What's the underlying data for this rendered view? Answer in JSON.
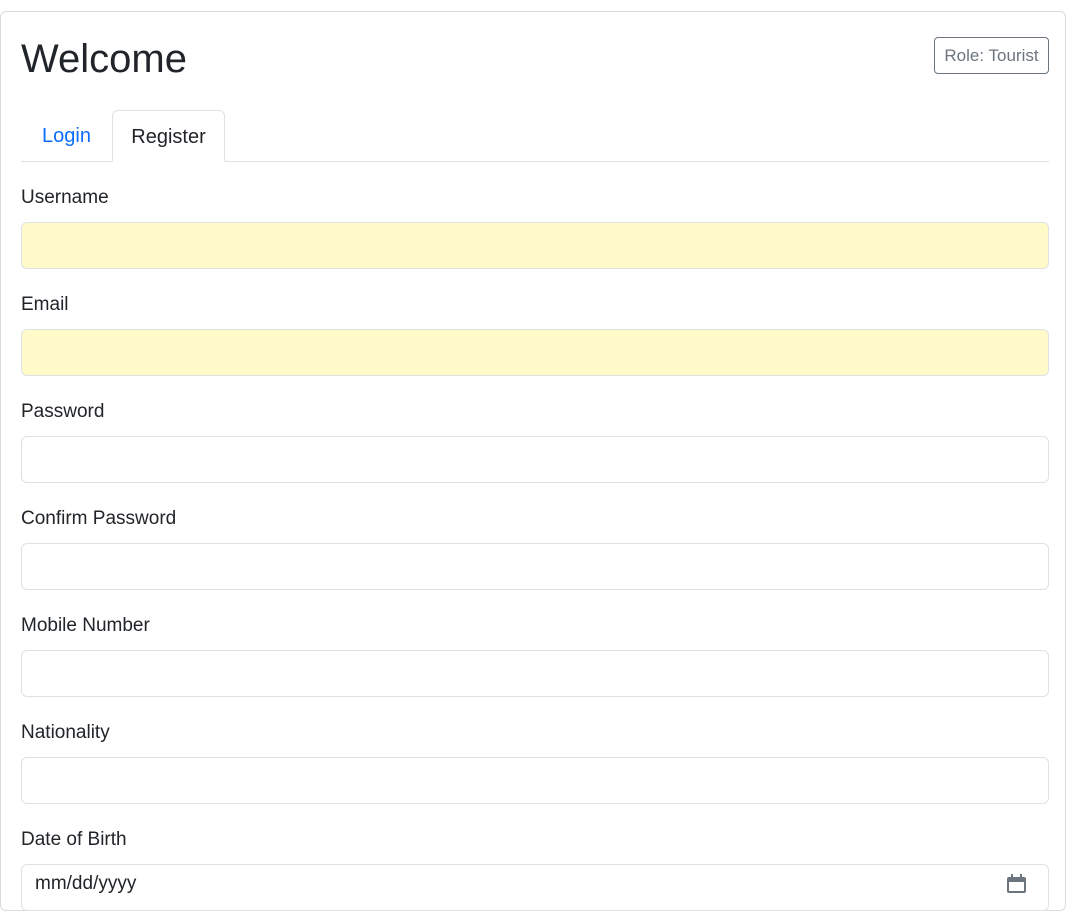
{
  "header": {
    "title": "Welcome",
    "role_badge": "Role: Tourist"
  },
  "tabs": [
    {
      "label": "Login",
      "active": false
    },
    {
      "label": "Register",
      "active": true
    }
  ],
  "form": {
    "username_label": "Username",
    "username_value": "",
    "email_label": "Email",
    "email_value": "",
    "password_label": "Password",
    "confirm_password_label": "Confirm Password",
    "mobile_label": "Mobile Number",
    "nationality_label": "Nationality",
    "dob_label": "Date of Birth",
    "dob_placeholder": "mm/dd/yyyy"
  },
  "colors": {
    "accent": "#0d6efd",
    "autofill": "#fffac8",
    "border": "#dee2e6",
    "badge": "#6c757d"
  },
  "icons": {
    "date": "calendar-icon"
  }
}
